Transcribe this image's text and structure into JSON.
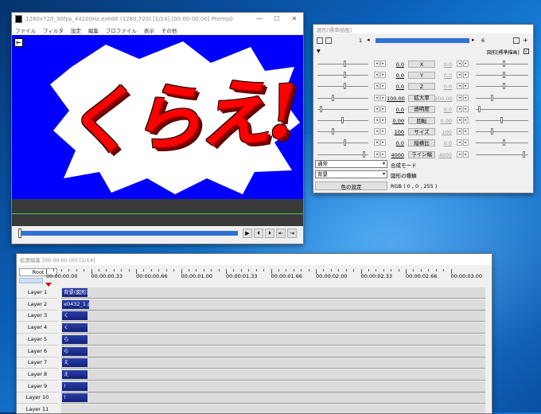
{
  "main_window": {
    "title": "1280x720_30fps_44100Hz.exedit (1280,720)  [1/14] [00:00:00.00]  Ptemp0",
    "menu": [
      "ファイル",
      "フィルタ",
      "設定",
      "編集",
      "プロファイル",
      "表示",
      "その他"
    ],
    "preview_text": "くらえ!",
    "preview_bg": "#0000ff",
    "text_color": "#ff0000"
  },
  "object_window": {
    "title": "図形[標準描画]",
    "frame_start": "1",
    "frame_end": "6",
    "header_right": "図形[標準描画]",
    "params": [
      {
        "label": "X",
        "left": "0.0",
        "right": "0.0"
      },
      {
        "label": "Y",
        "left": "0.0",
        "right": "0.0"
      },
      {
        "label": "Z",
        "left": "0.0",
        "right": "0.0"
      },
      {
        "label": "拡大率",
        "left": "100.00",
        "right": "100.00"
      },
      {
        "label": "透明度",
        "left": "0.0",
        "right": "0.0"
      },
      {
        "label": "回転",
        "left": "0.00",
        "right": "0.00"
      },
      {
        "label": "サイズ",
        "left": "100",
        "right": "100"
      },
      {
        "label": "縦横比",
        "left": "0.0",
        "right": "0.0"
      },
      {
        "label": "ライン幅",
        "left": "4000",
        "right": "4000"
      }
    ],
    "blend_value": "通常",
    "blend_label": "合成モード",
    "shape_value": "背景",
    "shape_label": "図形の種類",
    "color_button": "色の設定",
    "color_value": "RGB ( 0 , 0 , 255 )"
  },
  "timeline": {
    "title": "拡張編集 [00:00:00.00] [1/14]",
    "root": "Root",
    "ticks": [
      "00:00:00.00",
      "00:00:00.33",
      "00:00:00.66",
      "00:00:01.00",
      "00:00:01.33",
      "00:00:01.66",
      "00:00:02.00",
      "00:00:02.33",
      "00:00:02.66",
      "00:00:03.00"
    ],
    "layers": [
      {
        "name": "Layer 1",
        "clip": "背景(図形)"
      },
      {
        "name": "Layer 2",
        "clip": "e0432_1.png"
      },
      {
        "name": "Layer 3",
        "clip": "く"
      },
      {
        "name": "Layer 4",
        "clip": "く"
      },
      {
        "name": "Layer 5",
        "clip": "ら"
      },
      {
        "name": "Layer 6",
        "clip": "ら"
      },
      {
        "name": "Layer 7",
        "clip": "え"
      },
      {
        "name": "Layer 8",
        "clip": "え"
      },
      {
        "name": "Layer 9",
        "clip": "!"
      },
      {
        "name": "Layer 10",
        "clip": "!"
      },
      {
        "name": "Layer 11",
        "clip": ""
      }
    ]
  }
}
